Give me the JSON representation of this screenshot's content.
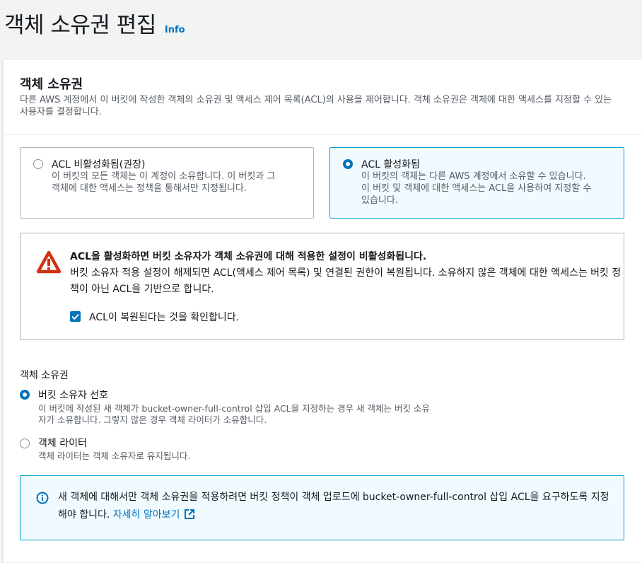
{
  "header": {
    "title": "객체 소유권 편집",
    "info_link": "Info"
  },
  "section": {
    "title": "객체 소유권",
    "description": "다른 AWS 계정에서 이 버킷에 작성한 객체의 소유권 및 액세스 제어 목록(ACL)의 사용을 제어합니다. 객체 소유권은 객체에 대한 액세스를 지정할 수 있는 사용자를 결정합니다."
  },
  "acl_options": [
    {
      "title": "ACL 비활성화됨(권장)",
      "desc_line1": "이 버킷의 모든 객체는 이 계정이 소유합니다. 이 버킷과 그",
      "desc_line2": "객체에 대한 액세스는 정책을 통해서만 지정됩니다.",
      "selected": false
    },
    {
      "title": "ACL 활성화됨",
      "desc_line1": "이 버킷의 객체는 다른 AWS 계정에서 소유할 수 있습니다.",
      "desc_line2": "이 버킷 및 객체에 대한 액세스는 ACL을 사용하여 지정할 수",
      "desc_line3": "있습니다.",
      "selected": true
    }
  ],
  "warning": {
    "icon": "warning-triangle-icon",
    "title": "ACL을 활성화하면 버킷 소유자가 객체 소유권에 대해 적용한 설정이 비활성화됩니다.",
    "text": "버킷 소유자 적용 설정이 해제되면 ACL(액세스 제어 목록) 및 연결된 권한이 복원됩니다. 소유하지 않은 객체에 대한 액세스는 버킷 정책이 아닌 ACL을 기반으로 합니다.",
    "checkbox_label": "ACL이 복원된다는 것을 확인합니다.",
    "checked": true
  },
  "ownership": {
    "label": "객체 소유권",
    "options": [
      {
        "title": "버킷 소유자 선호",
        "desc_line1": "이 버킷에 작성된 새 객체가 bucket-owner-full-control 삽입 ACL을 지정하는 경우 새 객체는 버킷 소유",
        "desc_line2": "자가 소유합니다. 그렇지 않은 경우 객체 라이터가 소유합니다.",
        "selected": true
      },
      {
        "title": "객체 라이터",
        "desc_line1": "객체 라이터는 객체 소유자로 유지됩니다.",
        "selected": false
      }
    ]
  },
  "info_alert": {
    "icon": "info-circle-icon",
    "text": "새 객체에 대해서만 객체 소유권을 적용하려면 버킷 정책이 객체 업로드에 bucket-owner-full-control 삽입 ACL을 요구하도록 지정해야 합니다.",
    "link": "자세히 알아보기",
    "link_icon": "external-link-icon"
  },
  "colors": {
    "accent": "#0073bb",
    "warning": "#d13212",
    "info_border": "#00a1c9"
  }
}
